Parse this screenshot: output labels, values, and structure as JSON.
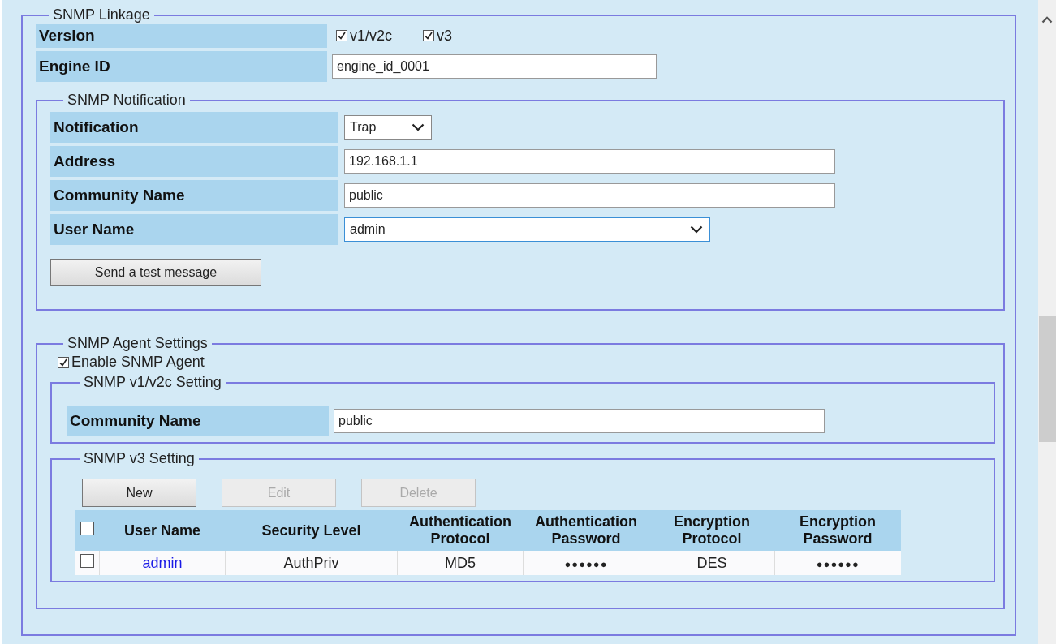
{
  "snmp_linkage": {
    "legend": "SNMP Linkage",
    "version": {
      "label": "Version",
      "options": [
        {
          "label": "v1/v2c",
          "checked": true
        },
        {
          "label": "v3",
          "checked": true
        }
      ]
    },
    "engine_id": {
      "label": "Engine ID",
      "value": "engine_id_0001"
    },
    "notification": {
      "legend": "SNMP Notification",
      "rows": [
        {
          "kind": "select",
          "label": "Notification",
          "value": "Trap"
        },
        {
          "kind": "text",
          "label": "Address",
          "value": "192.168.1.1"
        },
        {
          "kind": "text",
          "label": "Community Name",
          "value": "public"
        },
        {
          "kind": "select",
          "label": "User Name",
          "value": "admin"
        }
      ],
      "test_button": "Send a test message"
    },
    "agent": {
      "legend": "SNMP Agent Settings",
      "enable": {
        "label": "Enable SNMP Agent",
        "checked": true
      },
      "v1": {
        "legend": "SNMP v1/v2c Setting",
        "label": "Community Name",
        "value": "public"
      },
      "v3": {
        "legend": "SNMP v3 Setting",
        "buttons": [
          {
            "label": "New",
            "disabled": false
          },
          {
            "label": "Edit",
            "disabled": true
          },
          {
            "label": "Delete",
            "disabled": true
          }
        ],
        "table": {
          "select_all_checked": false,
          "columns": [
            "User Name",
            "Security Level",
            "Authentication Protocol",
            "Authentication Password",
            "Encryption Protocol",
            "Encryption Password"
          ],
          "rows": [
            {
              "checked": false,
              "cells": [
                "admin",
                "AuthPriv",
                "MD5",
                "●●●●●●",
                "DES",
                "●●●●●●"
              ]
            }
          ]
        }
      }
    }
  }
}
